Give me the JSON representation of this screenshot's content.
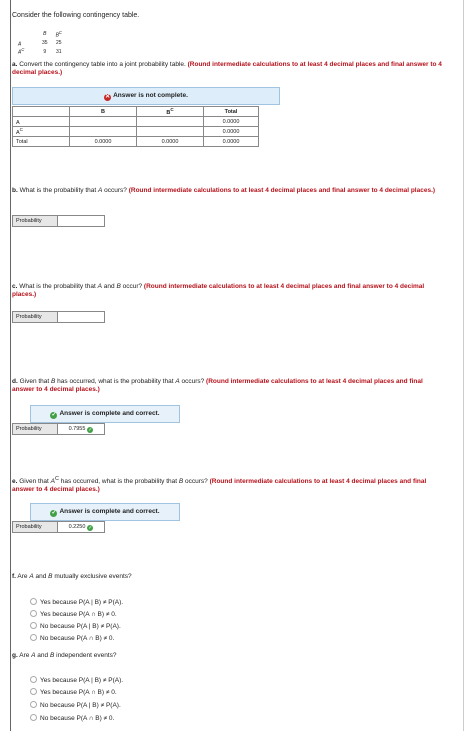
{
  "intro": "Consider the following contingency table.",
  "contingency": {
    "col_b": "B",
    "col_bc": "B",
    "col_bc_sup": "C",
    "rows": [
      {
        "label": "A",
        "sup": "",
        "b": "35",
        "bc": "25"
      },
      {
        "label": "A",
        "sup": "C",
        "b": "9",
        "bc": "31"
      }
    ]
  },
  "a": {
    "letter": "a.",
    "text": " Convert the contingency table into a joint probability table. ",
    "red": "(Round intermediate calculations to at least 4 decimal places and final answer to 4 decimal places.)",
    "banner": "Answer is not complete.",
    "table": {
      "h_b": "B",
      "h_bc": "B",
      "h_bc_sup": "C",
      "h_total": "Total",
      "rows": [
        {
          "label": "A",
          "sup": "",
          "b": "",
          "bc": "",
          "total": "0.0000"
        },
        {
          "label": "A",
          "sup": "C",
          "b": "",
          "bc": "",
          "total": "0.0000"
        },
        {
          "label": "Total",
          "sup": "",
          "b": "0.0000",
          "bc": "0.0000",
          "total": "0.0000"
        }
      ]
    }
  },
  "b": {
    "letter": "b.",
    "text1": " What is the probability that ",
    "var1": "A",
    "text2": " occurs? ",
    "red": "(Round intermediate calculations to at least 4 decimal places and final answer to 4 decimal places.)",
    "prob_label": "Probability",
    "prob_value": ""
  },
  "c": {
    "letter": "c.",
    "text1": " What is the probability that ",
    "var1": "A",
    "text2": " and ",
    "var2": "B",
    "text3": " occur? ",
    "red": "(Round intermediate calculations to at least 4 decimal places and final answer to 4 decimal places.)",
    "prob_label": "Probability",
    "prob_value": ""
  },
  "d": {
    "letter": "d.",
    "text1": " Given that ",
    "var1": "B",
    "text2": " has occurred, what is the probability that ",
    "var2": "A",
    "text3": " occurs? ",
    "red": "(Round intermediate calculations to at least 4 decimal places and final answer to 4 decimal places.)",
    "banner": "Answer is complete and correct.",
    "prob_label": "Probability",
    "prob_value": "0.7955"
  },
  "e": {
    "letter": "e.",
    "text1": " Given that ",
    "var1": "A",
    "var1_sup": "C",
    "text2": " has occurred, what is the probability that ",
    "var2": "B",
    "text3": " occurs? ",
    "red": "(Round intermediate calculations to at least 4 decimal places and final answer to 4 decimal places.)",
    "banner": "Answer is complete and correct.",
    "prob_label": "Probability",
    "prob_value": "0.2250"
  },
  "f": {
    "letter": "f.",
    "text1": " Are ",
    "var1": "A",
    "text2": " and ",
    "var2": "B",
    "text3": " mutually exclusive events?",
    "options": [
      "Yes because P(A | B) ≠ P(A).",
      "Yes because P(A ∩ B) ≠ 0.",
      "No because P(A | B) ≠ P(A).",
      "No because P(A ∩ B) ≠ 0."
    ]
  },
  "g": {
    "letter": "g.",
    "text1": " Are ",
    "var1": "A",
    "text2": " and ",
    "var2": "B",
    "text3": " independent events?",
    "options": [
      "Yes because P(A | B) ≠ P(A).",
      "Yes because P(A ∩ B) ≠ 0.",
      "No because P(A | B) ≠ P(A).",
      "No because P(A ∩ B) ≠ 0."
    ]
  },
  "icons": {
    "error": "x-circle-icon",
    "correct": "check-circle-icon",
    "radio": "radio-empty-icon"
  },
  "colors": {
    "red_text": "#b5121b",
    "banner_blue": "#ddeefa",
    "correct_green": "#43a047",
    "error_red": "#c62828"
  }
}
